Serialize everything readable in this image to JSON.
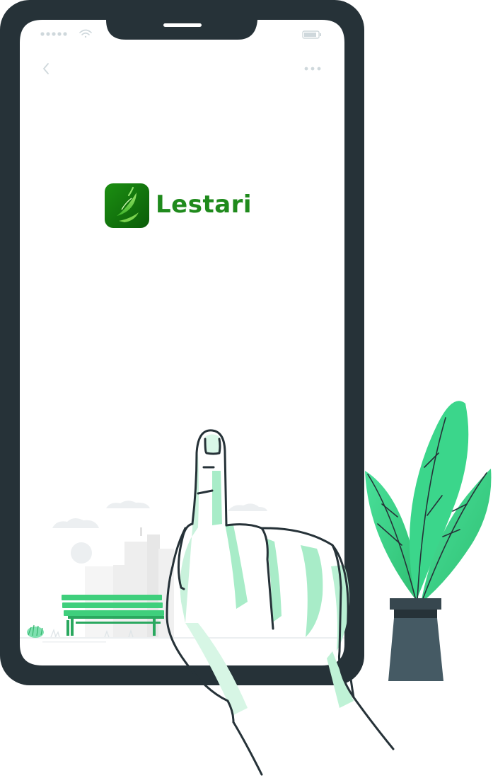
{
  "app": {
    "name": "Lestari"
  },
  "icons": {
    "signal": "signal-dots-icon",
    "wifi": "wifi-icon",
    "battery": "battery-icon",
    "back": "back-chevron-icon",
    "more": "more-dots-icon",
    "logo": "leaf-logo-icon"
  },
  "colors": {
    "phone_frame": "#263238",
    "brand_green": "#1f8a1c",
    "logo_dark": "#0b6e0b",
    "logo_light": "#4cc33a",
    "accent_mint": "#3ddc84",
    "plant_pot": "#455a64",
    "line_art": "#263238",
    "muted_gray": "#cfd8dc"
  }
}
